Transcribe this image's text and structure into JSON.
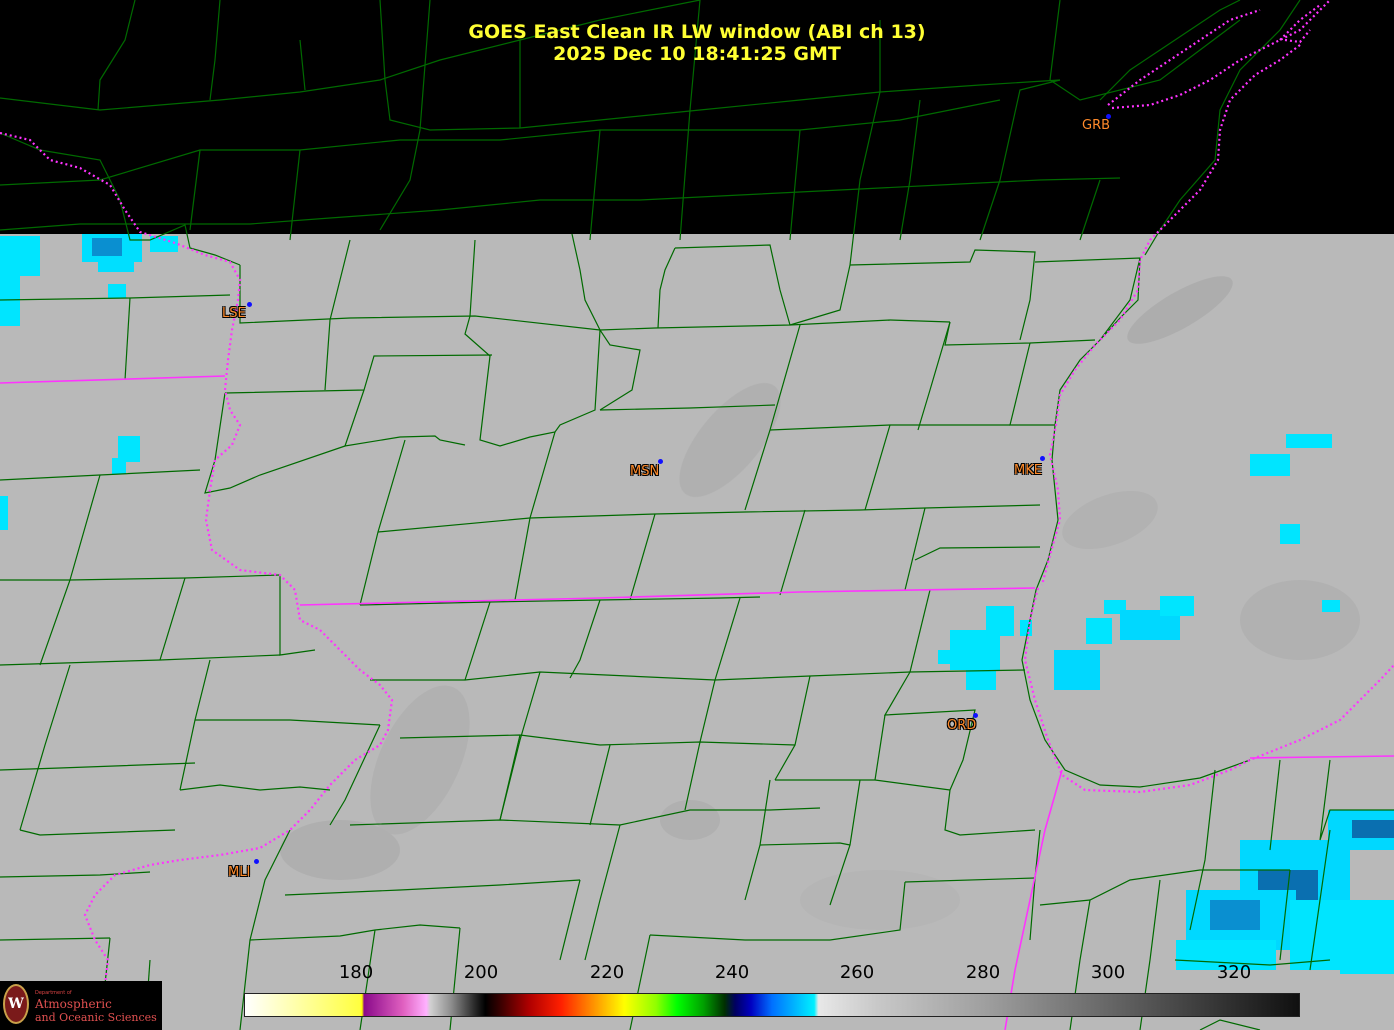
{
  "title": {
    "line1": "GOES East Clean IR LW window (ABI ch 13)",
    "line2": "2025 Dec 10  18:41:25 GMT"
  },
  "stations": [
    {
      "code": "GRB",
      "name": "station-grb"
    },
    {
      "code": "LSE",
      "name": "station-lse"
    },
    {
      "code": "MSN",
      "name": "station-msn"
    },
    {
      "code": "MKE",
      "name": "station-mke"
    },
    {
      "code": "ORD",
      "name": "station-ord"
    },
    {
      "code": "MLI",
      "name": "station-mli"
    }
  ],
  "colorbar": {
    "ticks": [
      "180",
      "200",
      "220",
      "240",
      "260",
      "280",
      "300",
      "320"
    ]
  },
  "logo": {
    "dept_line": "Department of",
    "line1": "Atmospheric",
    "line2": "and Oceanic Sciences",
    "seal_letter": "W"
  },
  "colors": {
    "title": "#ffff33",
    "county_lines": "#006400",
    "state_lines": "#ff33ff",
    "station_label": "#ff8a2a",
    "station_dot": "#1010ff",
    "cold_cloud": "#00e5ff"
  }
}
